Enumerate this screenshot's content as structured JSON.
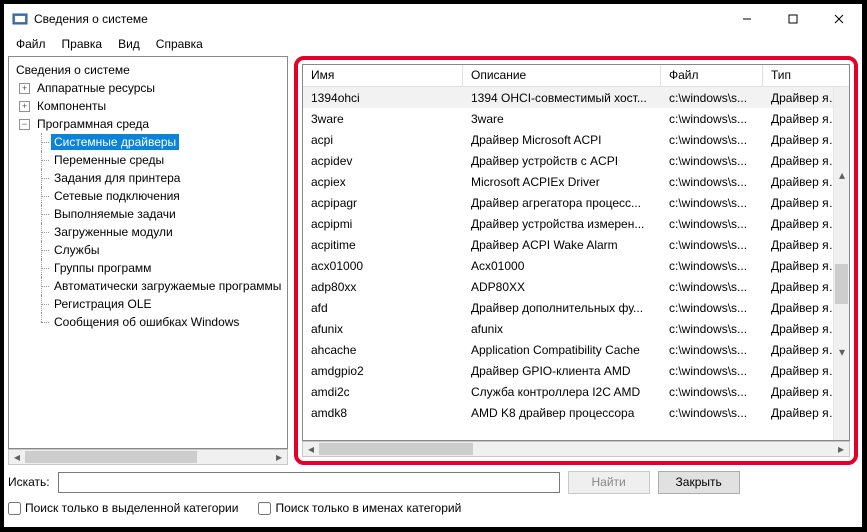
{
  "window": {
    "title": "Сведения о системе"
  },
  "menu": {
    "file": "Файл",
    "edit": "Правка",
    "view": "Вид",
    "help": "Справка"
  },
  "tree": {
    "root": "Сведения о системе",
    "hardware": "Аппаратные ресурсы",
    "components": "Компоненты",
    "software_env": "Программная среда",
    "system_drivers": "Системные драйверы",
    "env_vars": "Переменные среды",
    "print_jobs": "Задания для принтера",
    "net_conn": "Сетевые подключения",
    "running_tasks": "Выполняемые задачи",
    "loaded_modules": "Загруженные модули",
    "services": "Службы",
    "program_groups": "Группы программ",
    "autostart": "Автоматически загружаемые программы",
    "ole_reg": "Регистрация OLE",
    "wer": "Сообщения об ошибках Windows"
  },
  "columns": {
    "name": "Имя",
    "description": "Описание",
    "file": "Файл",
    "type": "Тип"
  },
  "rows": [
    {
      "name": "1394ohci",
      "desc": "1394 OHCI-совместимый хост...",
      "file": "c:\\windows\\s...",
      "type": "Драйвер ядра"
    },
    {
      "name": "3ware",
      "desc": "3ware",
      "file": "c:\\windows\\s...",
      "type": "Драйвер ядра"
    },
    {
      "name": "acpi",
      "desc": "Драйвер Microsoft ACPI",
      "file": "c:\\windows\\s...",
      "type": "Драйвер ядра"
    },
    {
      "name": "acpidev",
      "desc": "Драйвер устройств с ACPI",
      "file": "c:\\windows\\s...",
      "type": "Драйвер ядра"
    },
    {
      "name": "acpiex",
      "desc": "Microsoft ACPIEx Driver",
      "file": "c:\\windows\\s...",
      "type": "Драйвер ядра"
    },
    {
      "name": "acpipagr",
      "desc": "Драйвер агрегатора процесс...",
      "file": "c:\\windows\\s...",
      "type": "Драйвер ядра"
    },
    {
      "name": "acpipmi",
      "desc": "Драйвер устройства измерен...",
      "file": "c:\\windows\\s...",
      "type": "Драйвер ядра"
    },
    {
      "name": "acpitime",
      "desc": "Драйвер ACPI Wake Alarm",
      "file": "c:\\windows\\s...",
      "type": "Драйвер ядра"
    },
    {
      "name": "acx01000",
      "desc": "Acx01000",
      "file": "c:\\windows\\s...",
      "type": "Драйвер ядра"
    },
    {
      "name": "adp80xx",
      "desc": "ADP80XX",
      "file": "c:\\windows\\s...",
      "type": "Драйвер ядра"
    },
    {
      "name": "afd",
      "desc": "Драйвер дополнительных фу...",
      "file": "c:\\windows\\s...",
      "type": "Драйвер ядра"
    },
    {
      "name": "afunix",
      "desc": "afunix",
      "file": "c:\\windows\\s...",
      "type": "Драйвер ядра"
    },
    {
      "name": "ahcache",
      "desc": "Application Compatibility Cache",
      "file": "c:\\windows\\s...",
      "type": "Драйвер ядра"
    },
    {
      "name": "amdgpio2",
      "desc": "Драйвер GPIO-клиента AMD",
      "file": "c:\\windows\\s...",
      "type": "Драйвер ядра"
    },
    {
      "name": "amdi2c",
      "desc": "Служба контроллера I2C AMD",
      "file": "c:\\windows\\s...",
      "type": "Драйвер ядра"
    },
    {
      "name": "amdk8",
      "desc": "AMD K8 драйвер процессора",
      "file": "c:\\windows\\s...",
      "type": "Драйвер ядра"
    }
  ],
  "search": {
    "label": "Искать:",
    "find_btn": "Найти",
    "close_btn": "Закрыть",
    "check_selected_cat": "Поиск только в выделенной категории",
    "check_names_only": "Поиск только в именах категорий",
    "placeholder": ""
  }
}
